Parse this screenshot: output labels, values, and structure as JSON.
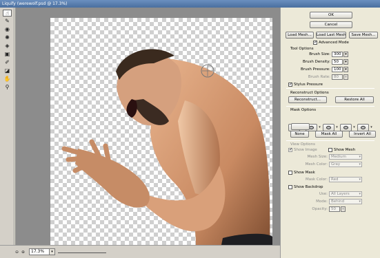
{
  "window": {
    "title": "Liquify (werewolf.psd @ 17.3%)"
  },
  "toolbar": {
    "tools": [
      {
        "name": "forward-warp-icon",
        "glyph": "☝"
      },
      {
        "name": "reconstruct-icon",
        "glyph": "✎"
      },
      {
        "name": "twirl-icon",
        "glyph": "◉"
      },
      {
        "name": "pucker-icon",
        "glyph": "✺"
      },
      {
        "name": "bloat-icon",
        "glyph": "◈"
      },
      {
        "name": "push-left-icon",
        "glyph": "▣"
      },
      {
        "name": "freeze-mask-icon",
        "glyph": "✐"
      },
      {
        "name": "thaw-mask-icon",
        "glyph": "◪"
      },
      {
        "name": "hand-icon",
        "glyph": "✋"
      },
      {
        "name": "zoom-icon",
        "glyph": "⚲"
      }
    ]
  },
  "status": {
    "zoom_value": "17.3%",
    "minus": "⊖",
    "plus": "⊕",
    "arrow": "▾"
  },
  "panel": {
    "ok": "OK",
    "cancel": "Cancel",
    "load_mesh": "Load Mesh...",
    "load_last_mesh": "Load Last Mesh",
    "save_mesh": "Save Mesh...",
    "advanced_mode": "Advanced Mode",
    "tool_options": {
      "title": "Tool Options",
      "brush_size_label": "Brush Size:",
      "brush_size": "300",
      "brush_density_label": "Brush Density:",
      "brush_density": "50",
      "brush_pressure_label": "Brush Pressure:",
      "brush_pressure": "100",
      "brush_rate_label": "Brush Rate:",
      "brush_rate": "80",
      "stylus_pressure": "Stylus Pressure"
    },
    "reconstruct": {
      "title": "Reconstruct Options",
      "reconstruct_btn": "Reconstruct...",
      "restore_all_btn": "Restore All"
    },
    "mask": {
      "title": "Mask Options",
      "none": "None",
      "mask_all": "Mask All",
      "invert_all": "Invert All"
    },
    "view": {
      "title": "View Options",
      "show_image": "Show Image",
      "show_mesh": "Show Mesh",
      "mesh_size_label": "Mesh Size:",
      "mesh_size": "Medium",
      "mesh_color_label": "Mesh Color:",
      "mesh_color": "Gray",
      "show_mask": "Show Mask",
      "mask_color_label": "Mask Color:",
      "mask_color": "Red",
      "show_backdrop": "Show Backdrop",
      "use_label": "Use:",
      "use": "All Layers",
      "mode_label": "Mode:",
      "mode": "Behind",
      "opacity_label": "Opacity:",
      "opacity": "50"
    }
  }
}
